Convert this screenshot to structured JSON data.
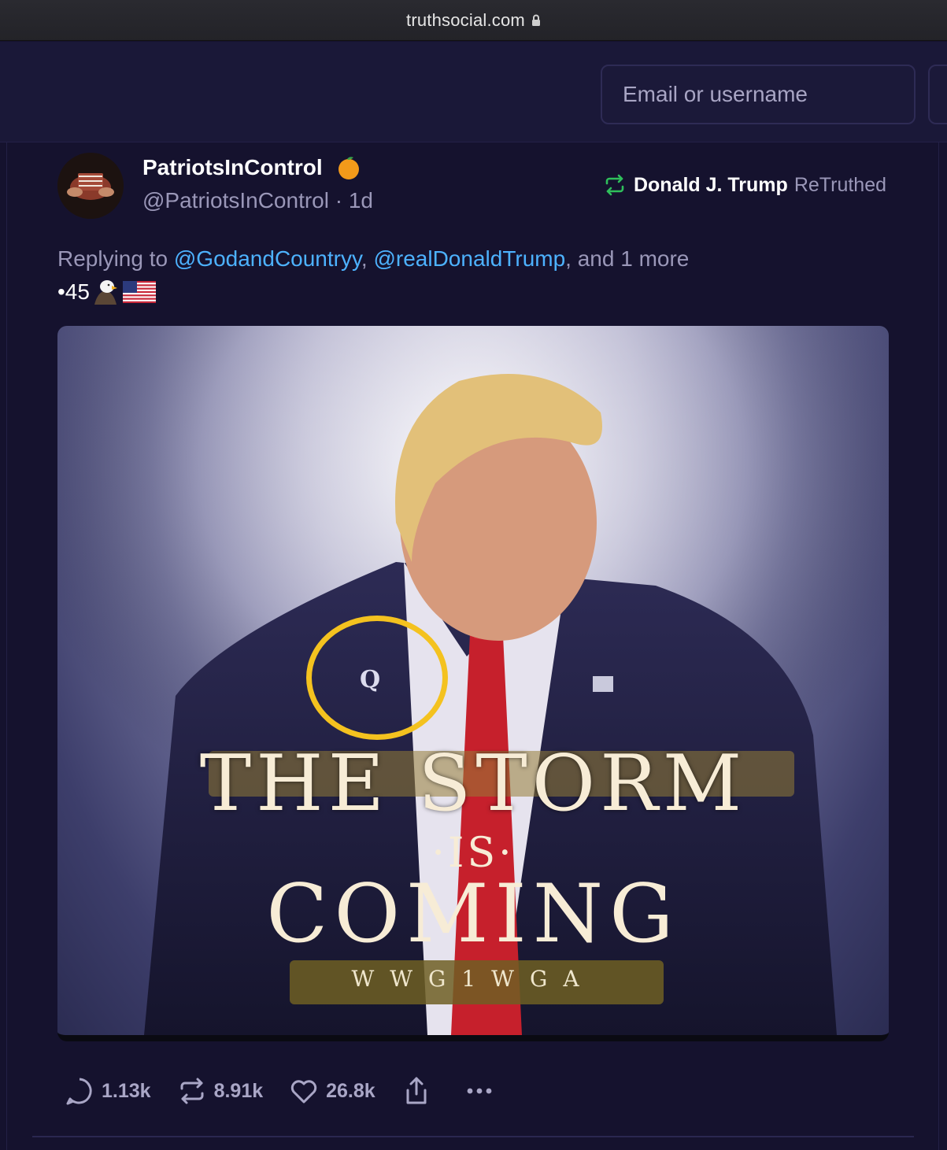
{
  "browser": {
    "url": "truthsocial.com"
  },
  "header": {
    "login_placeholder": "Email or username"
  },
  "post": {
    "author_name": "PatriotsInControl",
    "author_handle": "@PatriotsInControl · 1d",
    "retruth_by": "Donald J. Trump",
    "retruth_label": "ReTruthed",
    "replying_prefix": "Replying to ",
    "reply_mention_1": "@GodandCountryy",
    "reply_sep": ", ",
    "reply_mention_2": "@realDonaldTrump",
    "reply_suffix": ", and 1 more",
    "text": "•45",
    "image_text": {
      "line1": "THE STORM",
      "line2": "·IS·",
      "line3": "COMING",
      "line4": "WWG1WGA",
      "pin": "Q"
    },
    "actions": {
      "replies": "1.13k",
      "retruths": "8.91k",
      "likes": "26.8k"
    }
  },
  "colors": {
    "background": "#15122e",
    "link": "#4db2ff",
    "retruth_green": "#2fbf5b",
    "highlight": "#f4c21f"
  },
  "icons": [
    "lock-icon",
    "orange-badge-icon",
    "retruth-icon",
    "eagle-icon",
    "us-flag-icon",
    "reply-icon",
    "share-icon",
    "like-icon",
    "upload-icon",
    "more-icon"
  ]
}
